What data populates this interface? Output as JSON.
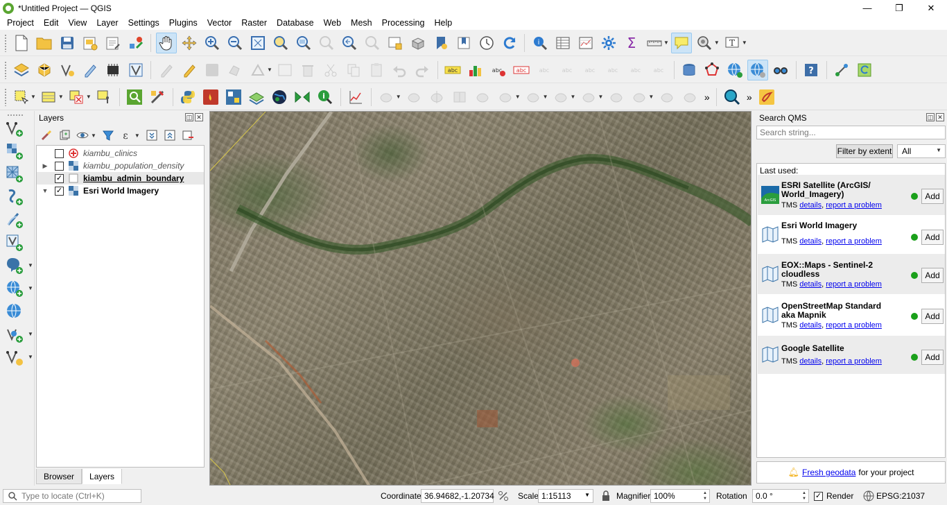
{
  "window": {
    "title": "*Untitled Project — QGIS",
    "minimize": "—",
    "restore": "❐",
    "close": "✕"
  },
  "menu": [
    "Project",
    "Edit",
    "View",
    "Layer",
    "Settings",
    "Plugins",
    "Vector",
    "Raster",
    "Database",
    "Web",
    "Mesh",
    "Processing",
    "Help"
  ],
  "layers_panel": {
    "title": "Layers",
    "layers": [
      {
        "name": "kiambu_clinics",
        "checked": false,
        "style": "italic",
        "icon": "point-layer-icon"
      },
      {
        "name": "kiambu_population_density",
        "checked": false,
        "style": "italic",
        "icon": "raster-layer-icon",
        "expandable": true
      },
      {
        "name": "kiambu_admin_boundary",
        "checked": true,
        "style": "bold-underline",
        "icon": "polygon-layer-icon",
        "selected": true
      },
      {
        "name": "Esri World Imagery",
        "checked": true,
        "style": "bold",
        "icon": "raster-layer-icon",
        "expanded": true
      }
    ],
    "tabs": [
      "Browser",
      "Layers"
    ],
    "active_tab": "Layers",
    "check_mark": "✓"
  },
  "qms": {
    "title": "Search QMS",
    "search_placeholder": "Search string...",
    "filter_button": "Filter by extent",
    "filter_select": "All",
    "last_used": "Last used:",
    "services": [
      {
        "name": "ESRI Satellite (ArcGIS/ World_Imagery)",
        "type": "TMS",
        "details": "details",
        "report": "report a problem",
        "status_color": "#1aa01a",
        "add": "Add"
      },
      {
        "name": "Esri World Imagery",
        "type": "TMS",
        "details": "details",
        "report": "report a problem",
        "status_color": "#1aa01a",
        "add": "Add"
      },
      {
        "name": "EOX::Maps - Sentinel-2 cloudless",
        "type": "TMS",
        "details": "details",
        "report": "report a problem",
        "status_color": "#1aa01a",
        "add": "Add"
      },
      {
        "name": "OpenStreetMap Standard aka Mapnik",
        "type": "TMS",
        "details": "details",
        "report": "report a problem",
        "status_color": "#1aa01a",
        "add": "Add"
      },
      {
        "name": "Google Satellite",
        "type": "TMS",
        "details": "details",
        "report": "report a problem",
        "status_color": "#1aa01a",
        "add": "Add"
      }
    ],
    "footer_link": "Fresh geodata",
    "footer_text": "for your project"
  },
  "statusbar": {
    "locate_placeholder": "Type to locate (Ctrl+K)",
    "coordinate_label": "Coordinate",
    "coordinate": "36.94682,-1.20734",
    "scale_label": "Scale",
    "scale": "1:15113",
    "magnifier_label": "Magnifier",
    "magnifier": "100%",
    "rotation_label": "Rotation",
    "rotation": "0.0 °",
    "render_label": "Render",
    "render_checked": true,
    "crs": "EPSG:21037"
  },
  "colors": {
    "accent": "#5aa531",
    "link": "#0000ee",
    "status_ok": "#1aa01a"
  }
}
